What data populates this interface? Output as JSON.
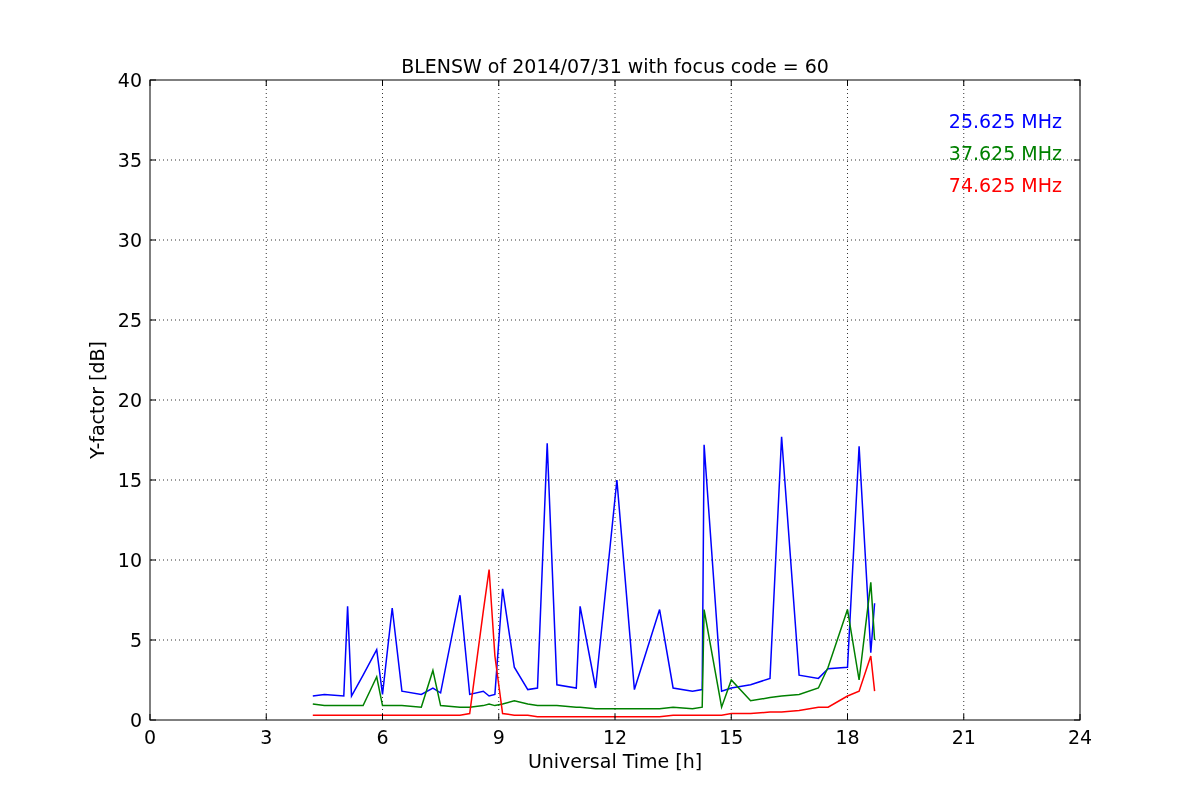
{
  "figure": {
    "chart_data": {
      "type": "line",
      "grid": true,
      "title": "BLENSW of 2014/07/31 with focus code = 60",
      "xlabel": "Universal Time [h]",
      "ylabel": "Y-factor [dB]",
      "xlim": [
        0,
        24
      ],
      "ylim": [
        0,
        40
      ],
      "xticks": [
        0,
        3,
        6,
        9,
        12,
        15,
        18,
        21,
        24
      ],
      "yticks": [
        0,
        5,
        10,
        15,
        20,
        25,
        30,
        35,
        40
      ],
      "x": [
        4.2,
        4.5,
        5.0,
        5.1,
        5.2,
        5.5,
        5.85,
        6.0,
        6.25,
        6.5,
        7.0,
        7.3,
        7.5,
        8.0,
        8.25,
        8.6,
        8.75,
        8.9,
        9.1,
        9.4,
        9.75,
        10.0,
        10.25,
        10.5,
        11.0,
        11.1,
        11.5,
        12.05,
        12.5,
        13.15,
        13.5,
        14.0,
        14.25,
        14.3,
        14.75,
        15.0,
        15.5,
        16.0,
        16.3,
        16.75,
        17.25,
        17.5,
        18.0,
        18.3,
        18.6,
        18.7
      ],
      "series": [
        {
          "name": "25.625 MHz",
          "color": "#0000ff",
          "values": [
            1.5,
            1.6,
            1.5,
            7.1,
            1.5,
            2.8,
            4.4,
            1.6,
            7.0,
            1.8,
            1.6,
            2.0,
            1.7,
            7.8,
            1.6,
            1.8,
            1.5,
            1.6,
            8.2,
            3.3,
            1.9,
            2.0,
            17.3,
            2.2,
            2.0,
            7.1,
            2.0,
            15.0,
            1.9,
            6.9,
            2.0,
            1.8,
            1.9,
            17.2,
            1.8,
            2.0,
            2.2,
            2.6,
            17.7,
            2.8,
            2.6,
            3.2,
            3.3,
            17.1,
            4.2,
            7.3
          ]
        },
        {
          "name": "37.625 MHz",
          "color": "#008000",
          "values": [
            1.0,
            0.9,
            0.9,
            0.9,
            0.9,
            0.9,
            2.7,
            0.9,
            0.9,
            0.9,
            0.8,
            3.1,
            0.9,
            0.8,
            0.8,
            0.9,
            1.0,
            0.9,
            1.0,
            1.2,
            1.0,
            0.9,
            0.9,
            0.9,
            0.8,
            0.8,
            0.7,
            0.7,
            0.7,
            0.7,
            0.8,
            0.7,
            0.8,
            6.9,
            0.8,
            2.5,
            1.2,
            1.4,
            1.5,
            1.6,
            2.0,
            3.3,
            6.9,
            2.5,
            8.6,
            5.0
          ]
        },
        {
          "name": "74.625 MHz",
          "color": "#ff0000",
          "values": [
            0.3,
            0.3,
            0.3,
            0.3,
            0.3,
            0.3,
            0.3,
            0.3,
            0.3,
            0.3,
            0.3,
            0.3,
            0.3,
            0.3,
            0.4,
            6.8,
            9.4,
            4.0,
            0.4,
            0.3,
            0.3,
            0.2,
            0.2,
            0.2,
            0.2,
            0.2,
            0.2,
            0.2,
            0.2,
            0.2,
            0.3,
            0.3,
            0.3,
            0.3,
            0.3,
            0.4,
            0.4,
            0.5,
            0.5,
            0.6,
            0.8,
            0.8,
            1.5,
            1.8,
            4.0,
            1.8
          ]
        }
      ]
    }
  }
}
